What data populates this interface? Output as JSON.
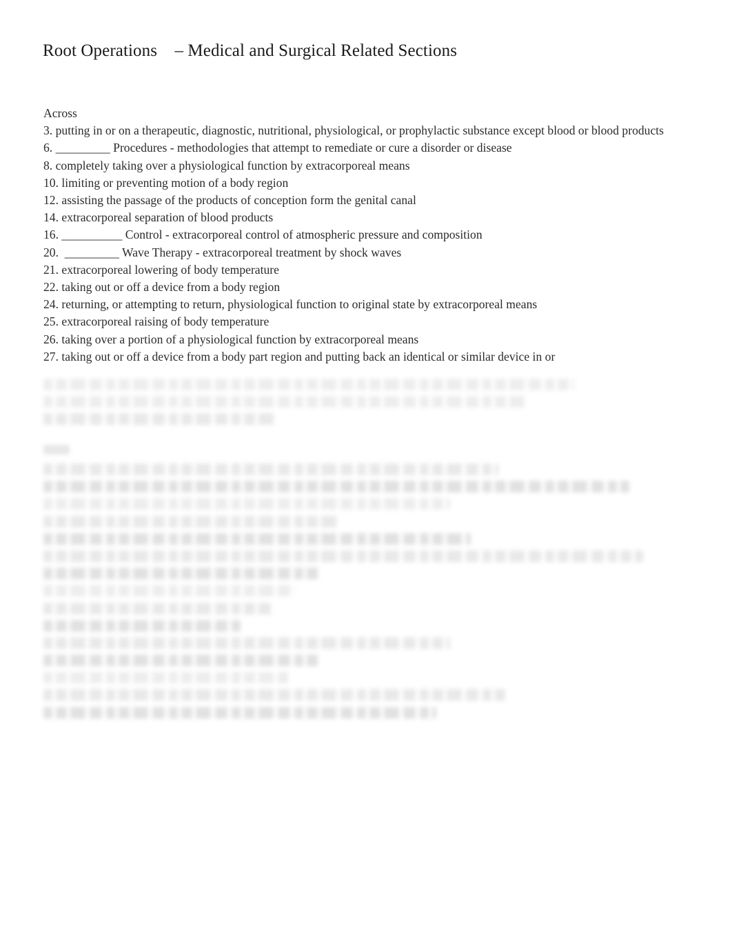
{
  "document": {
    "title": "Root Operations    – Medical and Surgical Related Sections",
    "background_color": "#ffffff",
    "text_color": "#2b2b2b"
  },
  "across": {
    "label": "Across",
    "clues": [
      "3. putting in or on a therapeutic, diagnostic, nutritional, physiological, or prophylactic substance except blood or blood products",
      "6. _________ Procedures - methodologies that attempt to remediate or cure a disorder or disease",
      "8. completely taking over a physiological function by extracorporeal means",
      "10. limiting or preventing motion of a body region",
      "12. assisting the passage of the products of conception form the genital canal",
      "14. extracorporeal separation of blood products",
      "16. __________ Control - extracorporeal control of atmospheric pressure and composition",
      "20.  _________ Wave Therapy - extracorporeal treatment by shock waves",
      "21. extracorporeal lowering of body temperature",
      "22. taking out or off a device from a body region",
      "24. returning, or attempting to return, physiological function to original state by extracorporeal means",
      "25. extracorporeal raising of body temperature",
      "26. taking over a portion of a physiological function by extracorporeal means",
      "27. taking out or off a device from a body part region and putting back an identical or similar device in or"
    ]
  },
  "illegible_regions": {
    "note": "remaining text is blurred and unreadable in the screenshot",
    "across_tail_line_widths": [
      770,
      700,
      340
    ],
    "down_heading_width": 38,
    "down_line_widths": [
      660,
      850,
      590,
      430,
      620,
      870,
      400,
      365,
      330,
      290,
      590,
      400,
      355,
      670,
      570
    ]
  }
}
